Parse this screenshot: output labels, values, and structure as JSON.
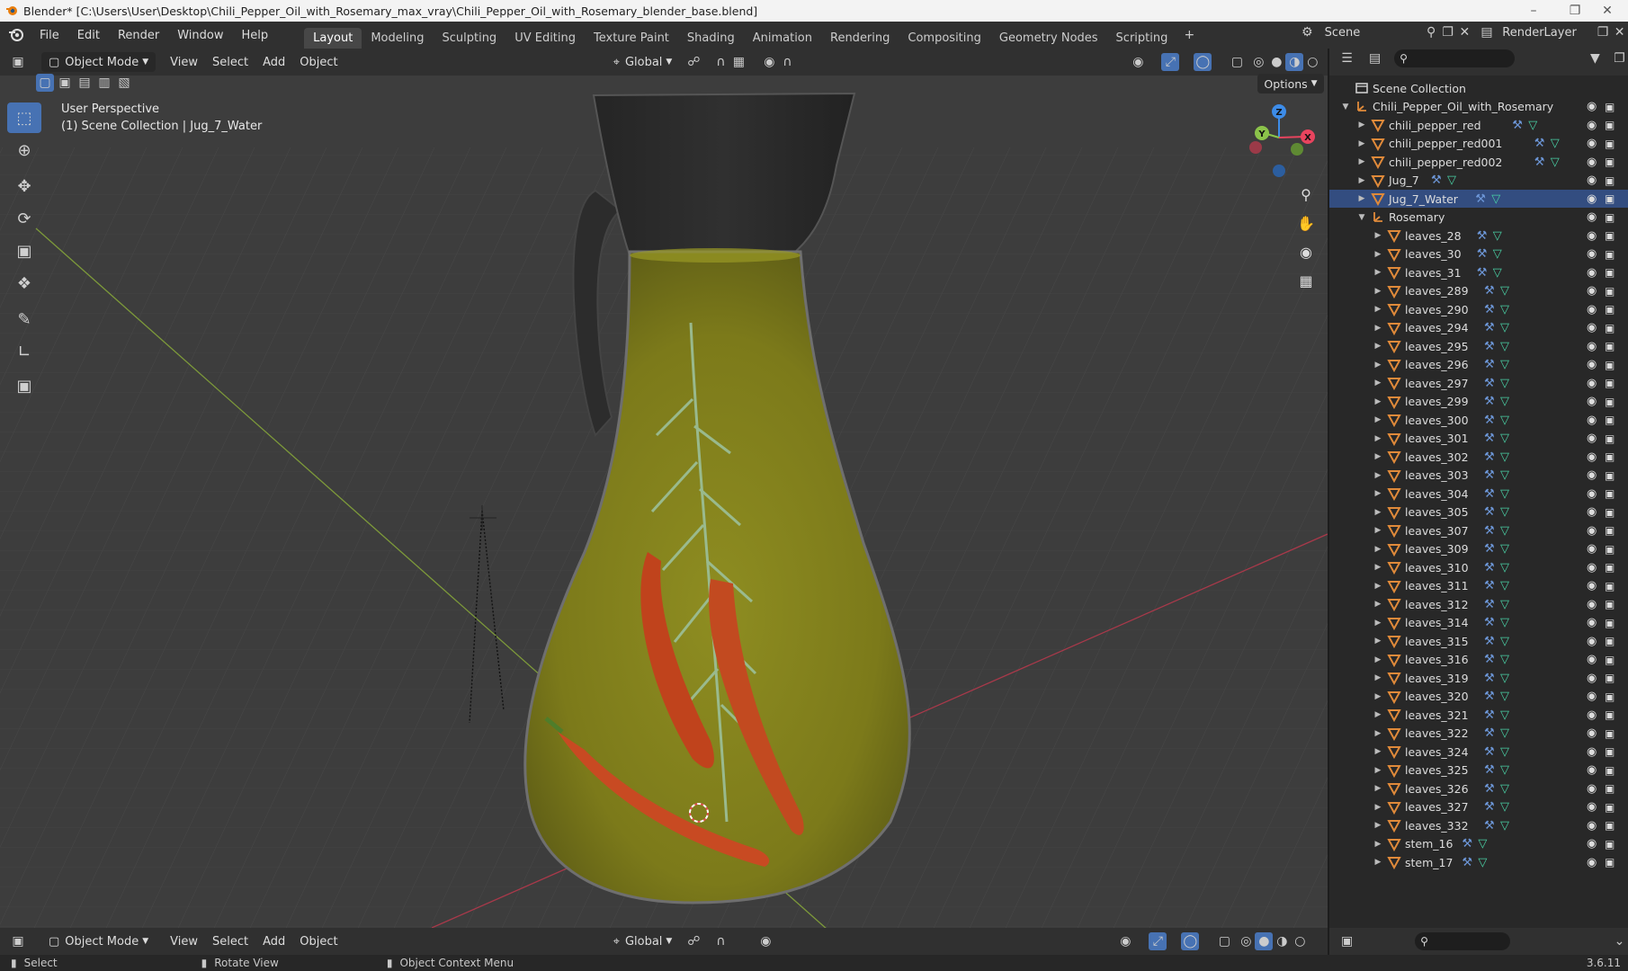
{
  "titlebar": {
    "title": "Blender* [C:\\Users\\User\\Desktop\\Chili_Pepper_Oil_with_Rosemary_max_vray\\Chili_Pepper_Oil_with_Rosemary_blender_base.blend]"
  },
  "menu": {
    "file": "File",
    "edit": "Edit",
    "render": "Render",
    "window": "Window",
    "help": "Help"
  },
  "workspaces": [
    "Layout",
    "Modeling",
    "Sculpting",
    "UV Editing",
    "Texture Paint",
    "Shading",
    "Animation",
    "Rendering",
    "Compositing",
    "Geometry Nodes",
    "Scripting"
  ],
  "active_workspace": "Layout",
  "scene": {
    "name": "Scene",
    "render_layer": "RenderLayer"
  },
  "viewport_header": {
    "mode": "Object Mode",
    "view": "View",
    "select": "Select",
    "add": "Add",
    "object": "Object",
    "orientation": "Global",
    "options": "Options"
  },
  "viewport": {
    "perspective": "User Perspective",
    "context": "(1) Scene Collection | Jug_7_Water"
  },
  "gizmo": {
    "x": "X",
    "y": "Y",
    "z": "Z"
  },
  "outliner": {
    "root": "Scene Collection",
    "collection": "Chili_Pepper_Oil_with_Rosemary",
    "objects": [
      "chili_pepper_red",
      "chili_pepper_red001",
      "chili_pepper_red002",
      "Jug_7",
      "Jug_7_Water"
    ],
    "selected": "Jug_7_Water",
    "group": "Rosemary",
    "children": [
      "leaves_28",
      "leaves_30",
      "leaves_31",
      "leaves_289",
      "leaves_290",
      "leaves_294",
      "leaves_295",
      "leaves_296",
      "leaves_297",
      "leaves_299",
      "leaves_300",
      "leaves_301",
      "leaves_302",
      "leaves_303",
      "leaves_304",
      "leaves_305",
      "leaves_307",
      "leaves_309",
      "leaves_310",
      "leaves_311",
      "leaves_312",
      "leaves_314",
      "leaves_315",
      "leaves_316",
      "leaves_319",
      "leaves_320",
      "leaves_321",
      "leaves_322",
      "leaves_324",
      "leaves_325",
      "leaves_326",
      "leaves_327",
      "leaves_332",
      "stem_16",
      "stem_17"
    ]
  },
  "statusbar": {
    "select": "Select",
    "rotate": "Rotate View",
    "context_menu": "Object Context Menu",
    "version": "3.6.11"
  },
  "colors": {
    "accent": "#4772b3",
    "x_axis": "#e8445e",
    "y_axis": "#8bc34a",
    "z_axis": "#3d8ce8",
    "oil": "#8a8a1a"
  },
  "icons": [
    "blender-logo-icon",
    "select-box-icon",
    "cursor-icon",
    "move-icon",
    "rotate-icon",
    "scale-icon",
    "transform-icon",
    "annotate-icon",
    "measure-icon",
    "add-cube-icon",
    "zoom-icon",
    "hand-icon",
    "camera-icon",
    "grid-icon",
    "eye-icon",
    "camera-render-icon",
    "search-icon",
    "filter-icon"
  ]
}
